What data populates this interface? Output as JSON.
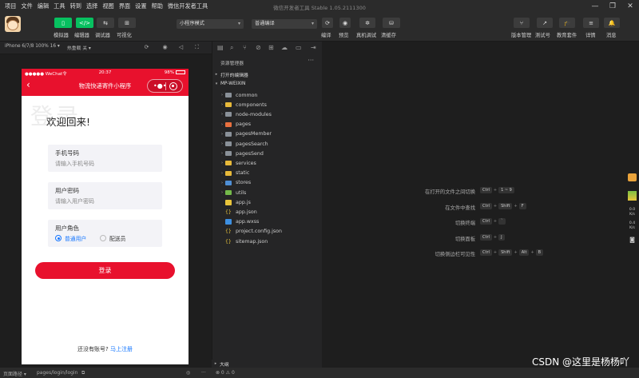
{
  "window": {
    "title": "微信开发者工具 Stable 1.05.2111300",
    "menu": [
      "项目",
      "文件",
      "编辑",
      "工具",
      "转到",
      "选择",
      "视图",
      "界面",
      "设置",
      "帮助",
      "微信开发者工具"
    ]
  },
  "toolbar": {
    "left_buttons": [
      {
        "icon": "phone-icon",
        "label": "模拟器"
      },
      {
        "icon": "code-icon",
        "label": "编辑器"
      },
      {
        "icon": "debug-icon",
        "label": "调试器"
      },
      {
        "icon": "visual-icon",
        "label": "可视化"
      }
    ],
    "mode_select": "小程序模式",
    "compile_select": "普通编译",
    "mid_buttons": [
      {
        "icon": "compile-icon",
        "label": "编译"
      },
      {
        "icon": "preview-icon",
        "label": "预览"
      },
      {
        "icon": "realdebug-icon",
        "label": "真机调试"
      },
      {
        "icon": "clearcache-icon",
        "label": "清缓存"
      }
    ],
    "right_buttons": [
      {
        "icon": "version-icon",
        "label": "版本管理"
      },
      {
        "icon": "test-icon",
        "label": "测试号"
      },
      {
        "icon": "edu-icon",
        "label": "教育套件"
      },
      {
        "icon": "details-icon",
        "label": "详情"
      },
      {
        "icon": "bell-icon",
        "label": "消息"
      }
    ]
  },
  "simulator": {
    "device": "iPhone 6/7/8 100% 16 ▾",
    "hotreload": "热重载 关 ▾",
    "status_left": "●●●●● WeChat令",
    "status_time": "20:37",
    "status_right": "98%",
    "nav_title": "物流快递寄件小程序",
    "page": {
      "bg_title": "登录",
      "welcome": "欢迎回来!",
      "fields": [
        {
          "label": "手机号码",
          "placeholder": "请输入手机号码"
        },
        {
          "label": "用户密码",
          "placeholder": "请输入用户密码"
        }
      ],
      "role_label": "用户角色",
      "roles": [
        "普通用户",
        "配送员"
      ],
      "login_button": "登录",
      "register_prompt": "还没有账号?",
      "register_link": "马上注册"
    }
  },
  "explorer": {
    "header": "资源管理器",
    "open_editors": "打开的编辑器",
    "project": "MP-WEIXIN",
    "items": [
      {
        "name": "common",
        "type": "folder",
        "color": "grey"
      },
      {
        "name": "components",
        "type": "folder",
        "color": "yellow"
      },
      {
        "name": "node-modules",
        "type": "folder",
        "color": "grey"
      },
      {
        "name": "pages",
        "type": "folder",
        "color": "orange"
      },
      {
        "name": "pagesMember",
        "type": "folder",
        "color": "grey"
      },
      {
        "name": "pagesSearch",
        "type": "folder",
        "color": "grey"
      },
      {
        "name": "pagesSend",
        "type": "folder",
        "color": "grey"
      },
      {
        "name": "services",
        "type": "folder",
        "color": "yellow"
      },
      {
        "name": "static",
        "type": "folder",
        "color": "yellow"
      },
      {
        "name": "stores",
        "type": "folder",
        "color": "blue"
      },
      {
        "name": "utils",
        "type": "folder",
        "color": "green"
      },
      {
        "name": "app.js",
        "type": "js"
      },
      {
        "name": "app.json",
        "type": "json"
      },
      {
        "name": "app.wxss",
        "type": "wxss"
      },
      {
        "name": "project.config.json",
        "type": "json"
      },
      {
        "name": "sitemap.json",
        "type": "json"
      }
    ],
    "outline": "大纲"
  },
  "shortcuts": [
    {
      "desc": "在打开的文件之间切换",
      "keys": [
        "Ctrl",
        "1 ~ 9"
      ]
    },
    {
      "desc": "在文件中查找",
      "keys": [
        "Ctrl",
        "Shift",
        "F"
      ]
    },
    {
      "desc": "切换终端",
      "keys": [
        "Ctrl",
        "`"
      ]
    },
    {
      "desc": "切换面板",
      "keys": [
        "Ctrl",
        "J"
      ]
    },
    {
      "desc": "切换侧边栏可见性",
      "keys": [
        "Ctrl",
        "Shift",
        "Alt",
        "B"
      ]
    }
  ],
  "rightstrip": {
    "net_down": "0.0",
    "net_down_unit": "K/s",
    "net_up": "0.4",
    "net_up_unit": "K/s"
  },
  "statusbar": {
    "page_path_label": "页面路径 ▾",
    "page_path": "pages/login/login",
    "errors": "⊗ 0 ⚠ 0"
  },
  "watermark": "CSDN @这里是杨杨吖",
  "colors": {
    "brand_red": "#e8112d",
    "wechat_green": "#07c160",
    "link_blue": "#1677ff"
  }
}
